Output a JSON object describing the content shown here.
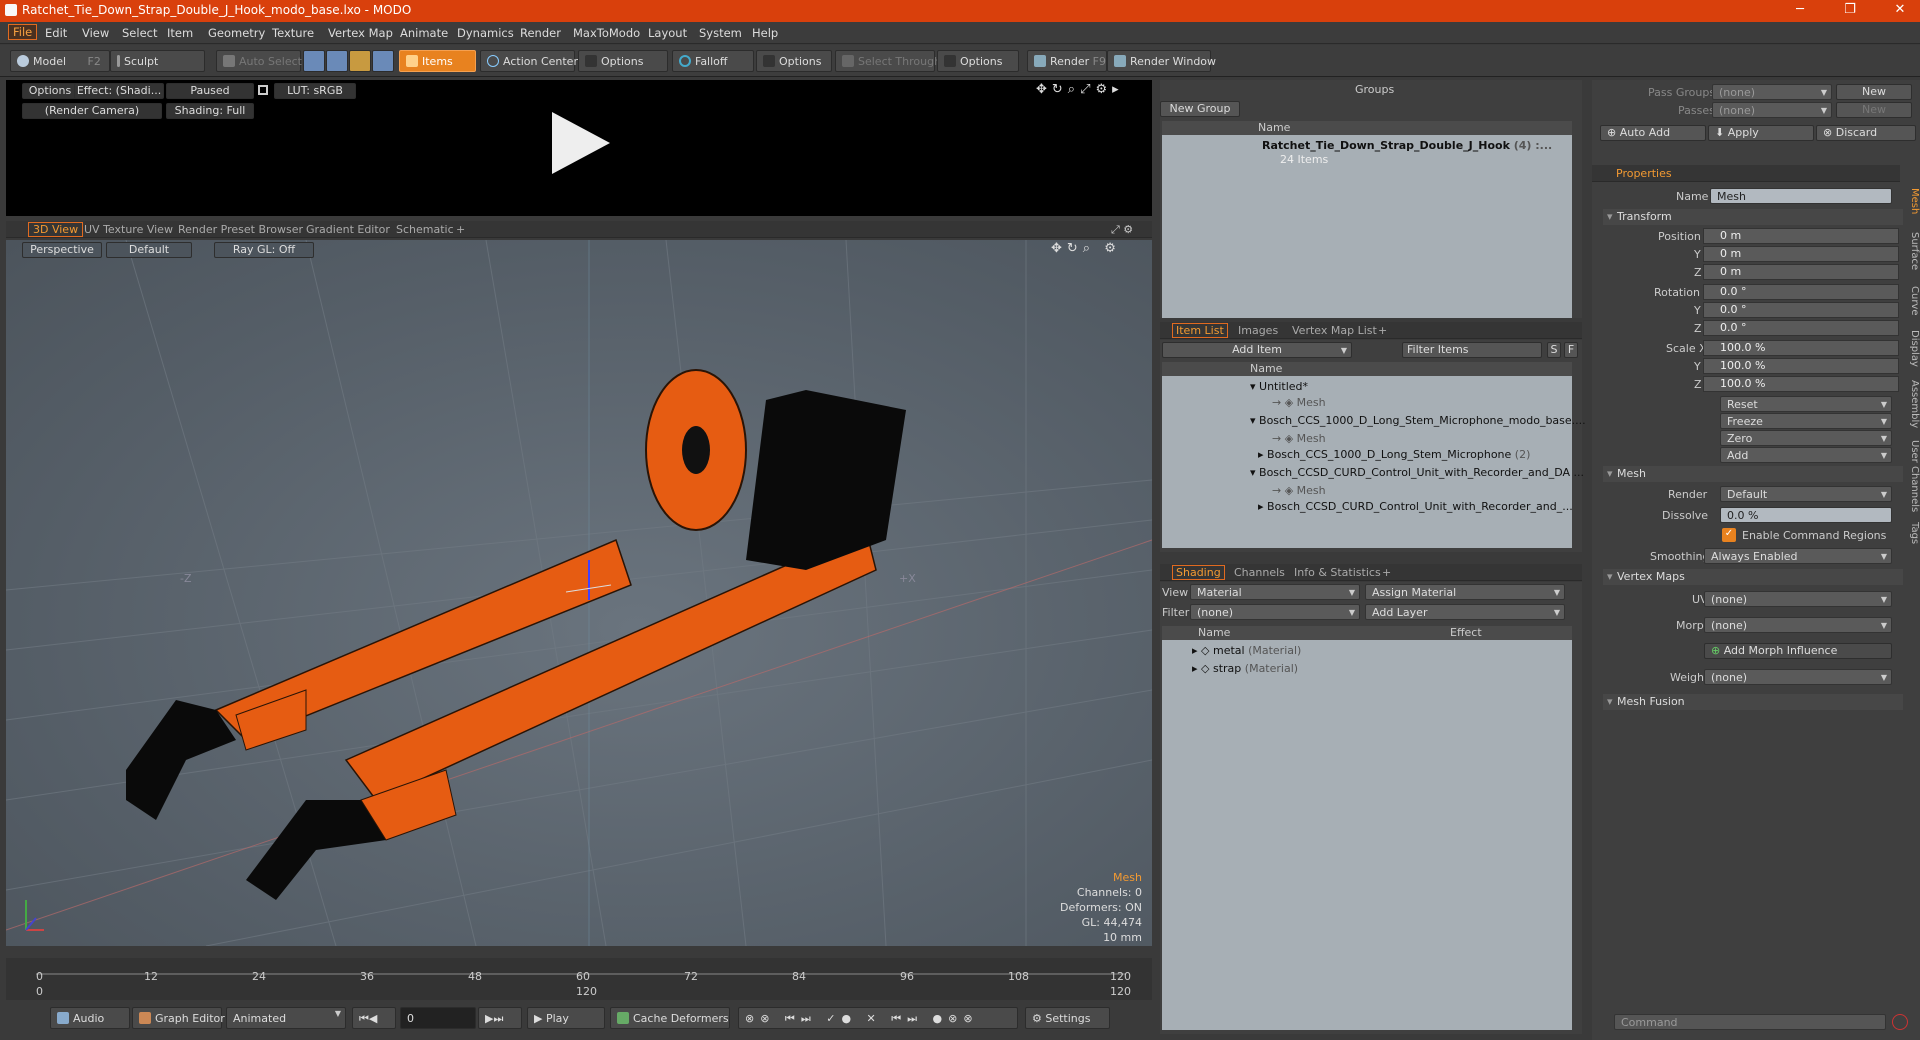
{
  "window": {
    "title": "Ratchet_Tie_Down_Strap_Double_J_Hook_modo_base.lxo - MODO"
  },
  "menu": [
    "File",
    "Edit",
    "View",
    "Select",
    "Item",
    "Geometry",
    "Texture",
    "Vertex Map",
    "Animate",
    "Dynamics",
    "Render",
    "MaxToModo",
    "Layout",
    "System",
    "Help"
  ],
  "toolbar": {
    "model": "Model",
    "model_key": "F2",
    "sculpt": "Sculpt",
    "auto_select": "Auto Select",
    "items": "Items",
    "action_center": "Action Center",
    "options1": "Options",
    "falloff": "Falloff",
    "options2": "Options",
    "select_through": "Select Through",
    "options3": "Options",
    "render": "Render",
    "render_key": "F9",
    "render_window": "Render Window"
  },
  "preview": {
    "options": "Options",
    "effect": "Effect: (Shadi...",
    "paused": "Paused",
    "lut": "LUT: sRGB",
    "camera": "(Render Camera)",
    "shading": "Shading: Full"
  },
  "viewport_tabs": [
    "3D View",
    "UV Texture View",
    "Render Preset Browser",
    "Gradient Editor",
    "Schematic",
    "+"
  ],
  "viewport": {
    "perspective": "Perspective",
    "default": "Default",
    "raygl": "Ray GL: Off",
    "axis_z": "-Z",
    "axis_x": "+X",
    "info": [
      "Mesh",
      "Channels: 0",
      "Deformers: ON",
      "GL: 44,474",
      "10 mm"
    ]
  },
  "colors": {
    "accent": "#f39a32",
    "strap": "#e65c12",
    "bg_viewport": "#5d6670",
    "title": "#d9400c"
  },
  "timeline": {
    "ticks": [
      "0",
      "12",
      "24",
      "36",
      "48",
      "60",
      "72",
      "84",
      "96",
      "108",
      "120"
    ],
    "start": "0",
    "end": "120",
    "end2": "120"
  },
  "bottombar": {
    "audio": "Audio",
    "graph_editor": "Graph Editor",
    "animated": "Animated",
    "frame": "0",
    "play": "Play",
    "cache": "Cache Deformers",
    "settings": "Settings"
  },
  "groups": {
    "title": "Groups",
    "new_group": "New Group",
    "col_name": "Name",
    "item": "Ratchet_Tie_Down_Strap_Double_J_Hook",
    "item_count": "(4) :...",
    "sub": "24 Items"
  },
  "itemlist": {
    "tabs": [
      "Item List",
      "Images",
      "Vertex Map List",
      "+"
    ],
    "add_item": "Add Item",
    "filter": "Filter Items",
    "s": "S",
    "f": "F",
    "col_name": "Name",
    "rows": [
      {
        "t": "Untitled*",
        "lvl": 0
      },
      {
        "t": "Mesh",
        "lvl": 1
      },
      {
        "t": "Bosch_CCS_1000_D_Long_Stem_Microphone_modo_base....",
        "lvl": 0
      },
      {
        "t": "Mesh",
        "lvl": 1
      },
      {
        "t": "Bosch_CCS_1000_D_Long_Stem_Microphone",
        "extra": "(2)",
        "lvl": 1
      },
      {
        "t": "Bosch_CCSD_CURD_Control_Unit_with_Recorder_and_DA ...",
        "lvl": 0
      },
      {
        "t": "Mesh",
        "lvl": 1
      },
      {
        "t": "Bosch_CCSD_CURD_Control_Unit_with_Recorder_and_...",
        "lvl": 1
      }
    ]
  },
  "shading": {
    "tabs": [
      "Shading",
      "Channels",
      "Info & Statistics",
      "+"
    ],
    "view_label": "View",
    "view_val": "Material",
    "assign": "Assign Material",
    "filter_label": "Filter",
    "filter_val": "(none)",
    "add_layer": "Add Layer",
    "col_name": "Name",
    "col_effect": "Effect",
    "rows": [
      {
        "name": "metal",
        "type": "(Material)"
      },
      {
        "name": "strap",
        "type": "(Material)"
      }
    ]
  },
  "props": {
    "pass_groups": "Pass Groups",
    "pass_val": "(none)",
    "new": "New",
    "passes": "Passes",
    "passes_val": "(none)",
    "new2": "New",
    "auto_add": "Auto Add",
    "apply": "Apply",
    "discard": "Discard",
    "tab": "Properties",
    "name_label": "Name",
    "name_val": "Mesh",
    "transform": "Transform",
    "pos_label": "Position X",
    "y": "Y",
    "z": "Z",
    "pos": [
      "0 m",
      "0 m",
      "0 m"
    ],
    "rot_label": "Rotation X",
    "rot": [
      "0.0 °",
      "0.0 °",
      "0.0 °"
    ],
    "scale_label": "Scale X",
    "scale": [
      "100.0 %",
      "100.0 %",
      "100.0 %"
    ],
    "reset": "Reset",
    "freeze": "Freeze",
    "zero": "Zero",
    "add": "Add",
    "mesh": "Mesh",
    "render_label": "Render",
    "render_val": "Default",
    "dissolve_label": "Dissolve",
    "dissolve_val": "0.0 %",
    "enable_cmd": "Enable Command Regions",
    "smoothing_label": "Smoothing",
    "smoothing_val": "Always Enabled",
    "vmaps": "Vertex Maps",
    "uv_label": "UV",
    "uv_val": "(none)",
    "morph_label": "Morph",
    "morph_val": "(none)",
    "add_morph": "Add Morph Influence",
    "weight_label": "Weight",
    "weight_val": "(none)",
    "fusion": "Mesh Fusion",
    "command": "Command"
  },
  "side_tabs": [
    "Mesh",
    "Surface",
    "Curve",
    "Display",
    "Assembly",
    "User Channels",
    "Tags"
  ]
}
